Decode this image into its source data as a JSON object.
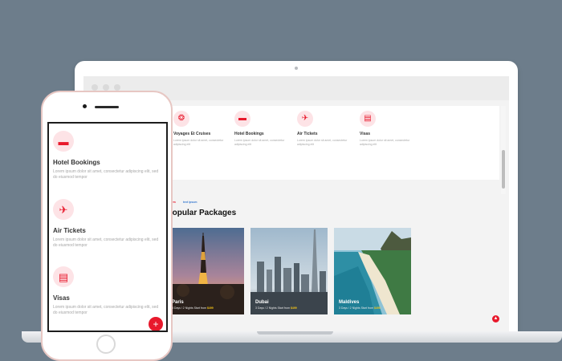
{
  "laptop": {
    "services": [
      {
        "icon": "passport-icon",
        "glyph": "❂",
        "title": "Voyages Et Cruises",
        "desc": "Lorem ipsum dolor sit amet, consectetur adipiscing elit"
      },
      {
        "icon": "bed-icon",
        "glyph": "▬",
        "title": "Hotel Bookings",
        "desc": "Lorem ipsum dolor sit amet, consectetur adipiscing elit"
      },
      {
        "icon": "plane-icon",
        "glyph": "✈",
        "title": "Air Tickets",
        "desc": "Lorem ipsum dolor sit amet, consectetur adipiscing elit"
      },
      {
        "icon": "visa-document-icon",
        "glyph": "▤",
        "title": "Visas",
        "desc": "Lorem ipsum dolor sit amet, consectetur adipiscing elit"
      }
    ],
    "section": {
      "tag_primary": "Lorem",
      "tag_secondary": "text ipsum",
      "title": "Popular Packages"
    },
    "packages": [
      {
        "name": "Paris",
        "meta": "3 Days / 2 Nights Start from ",
        "price": "$499"
      },
      {
        "name": "Dubai",
        "meta": "3 Days / 2 Nights Start from ",
        "price": "$499"
      },
      {
        "name": "Maldives",
        "meta": "3 Days / 2 Nights Start from ",
        "price": "$499"
      }
    ]
  },
  "phone": {
    "services": [
      {
        "icon": "bed-icon",
        "glyph": "▬",
        "title": "Hotel Bookings",
        "desc": "Lorem ipsum dolor sit amet, consectetur adipiscing elit, sed do eiusmod tempor"
      },
      {
        "icon": "plane-icon",
        "glyph": "✈",
        "title": "Air Tickets",
        "desc": "Lorem ipsum dolor sit amet, consectetur adipiscing elit, sed do eiusmod tempor"
      },
      {
        "icon": "visa-document-icon",
        "glyph": "▤",
        "title": "Visas",
        "desc": "Lorem ipsum dolor sit amet, consectetur adipiscing elit, sed do eiusmod tempor"
      }
    ],
    "fab_glyph": "+"
  },
  "colors": {
    "accent": "#e8192c",
    "accent_soft": "#fde3e6",
    "background": "#6d7d8b"
  }
}
